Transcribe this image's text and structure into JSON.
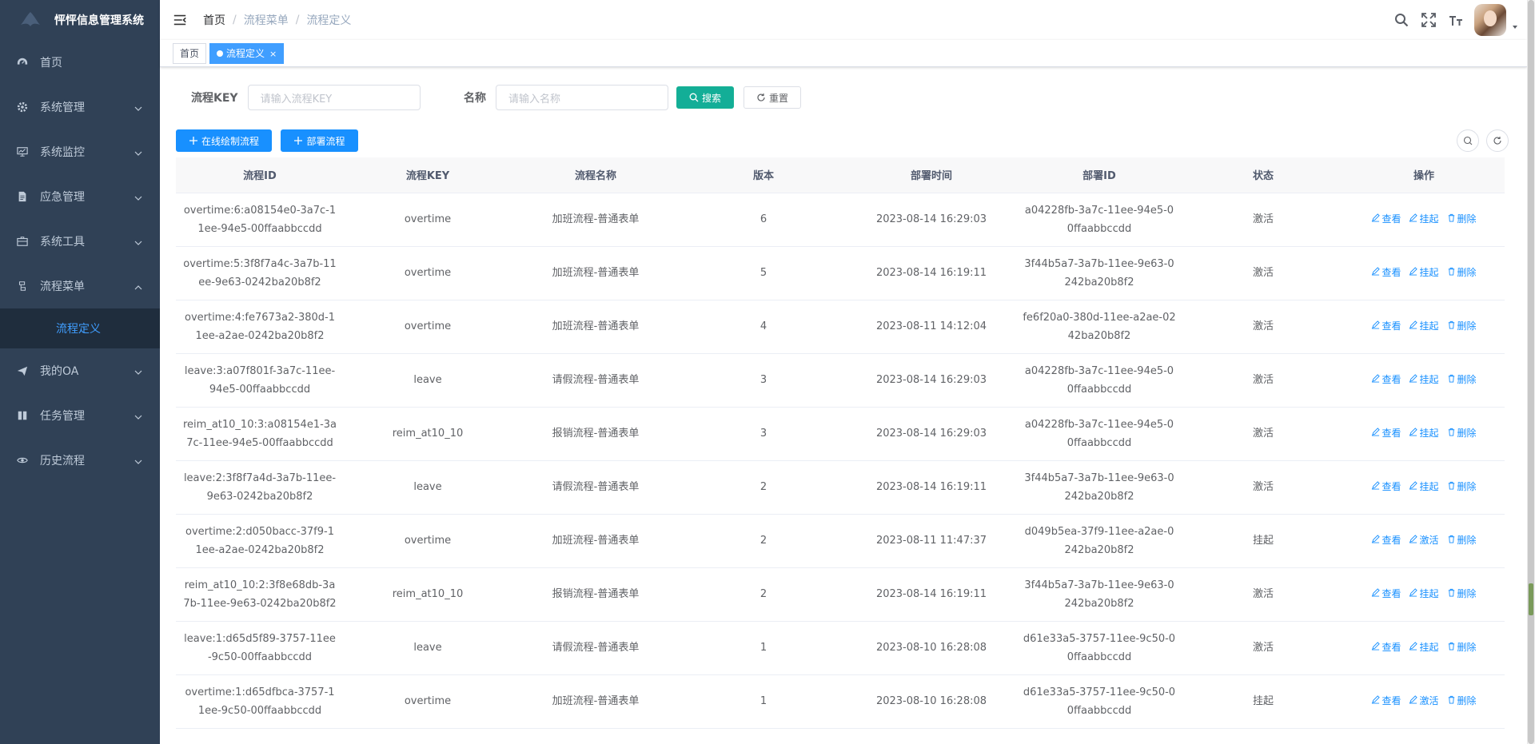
{
  "app": {
    "title": "怦怦信息管理系统"
  },
  "sidebar": {
    "items": [
      {
        "label": "首页",
        "icon": "dashboard-icon"
      },
      {
        "label": "系统管理",
        "icon": "gear-icon"
      },
      {
        "label": "系统监控",
        "icon": "monitor-icon"
      },
      {
        "label": "应急管理",
        "icon": "document-icon"
      },
      {
        "label": "系统工具",
        "icon": "toolbox-icon"
      },
      {
        "label": "流程菜单",
        "icon": "flow-icon"
      },
      {
        "label": "我的OA",
        "icon": "send-icon"
      },
      {
        "label": "任务管理",
        "icon": "book-icon"
      },
      {
        "label": "历史流程",
        "icon": "eye-icon"
      }
    ],
    "submenu": {
      "label": "流程定义"
    }
  },
  "breadcrumb": {
    "home": "首页",
    "level1": "流程菜单",
    "level2": "流程定义",
    "separator": "/"
  },
  "tags": {
    "home": "首页",
    "active": "流程定义",
    "close": "×"
  },
  "search": {
    "key_label": "流程KEY",
    "key_placeholder": "请输入流程KEY",
    "name_label": "名称",
    "name_placeholder": "请输入名称",
    "search_button": "搜索",
    "reset_button": "重置"
  },
  "toolbar": {
    "draw_button": "在线绘制流程",
    "deploy_button": "部署流程"
  },
  "table": {
    "headers": [
      "流程ID",
      "流程KEY",
      "流程名称",
      "版本",
      "部署时间",
      "部署ID",
      "状态",
      "操作"
    ],
    "action_view": "查看",
    "action_delete": "删除",
    "rows": [
      {
        "id": "overtime:6:a08154e0-3a7c-11ee-94e5-00ffaabbccdd",
        "key": "overtime",
        "name": "加班流程-普通表单",
        "version": "6",
        "time": "2023-08-14 16:29:03",
        "deploy_id": "a04228fb-3a7c-11ee-94e5-00ffaabbccdd",
        "status": "激活",
        "toggle": "挂起"
      },
      {
        "id": "overtime:5:3f8f7a4c-3a7b-11ee-9e63-0242ba20b8f2",
        "key": "overtime",
        "name": "加班流程-普通表单",
        "version": "5",
        "time": "2023-08-14 16:19:11",
        "deploy_id": "3f44b5a7-3a7b-11ee-9e63-0242ba20b8f2",
        "status": "激活",
        "toggle": "挂起"
      },
      {
        "id": "overtime:4:fe7673a2-380d-11ee-a2ae-0242ba20b8f2",
        "key": "overtime",
        "name": "加班流程-普通表单",
        "version": "4",
        "time": "2023-08-11 14:12:04",
        "deploy_id": "fe6f20a0-380d-11ee-a2ae-0242ba20b8f2",
        "status": "激活",
        "toggle": "挂起"
      },
      {
        "id": "leave:3:a07f801f-3a7c-11ee-94e5-00ffaabbccdd",
        "key": "leave",
        "name": "请假流程-普通表单",
        "version": "3",
        "time": "2023-08-14 16:29:03",
        "deploy_id": "a04228fb-3a7c-11ee-94e5-00ffaabbccdd",
        "status": "激活",
        "toggle": "挂起"
      },
      {
        "id": "reim_at10_10:3:a08154e1-3a7c-11ee-94e5-00ffaabbccdd",
        "key": "reim_at10_10",
        "name": "报销流程-普通表单",
        "version": "3",
        "time": "2023-08-14 16:29:03",
        "deploy_id": "a04228fb-3a7c-11ee-94e5-00ffaabbccdd",
        "status": "激活",
        "toggle": "挂起"
      },
      {
        "id": "leave:2:3f8f7a4d-3a7b-11ee-9e63-0242ba20b8f2",
        "key": "leave",
        "name": "请假流程-普通表单",
        "version": "2",
        "time": "2023-08-14 16:19:11",
        "deploy_id": "3f44b5a7-3a7b-11ee-9e63-0242ba20b8f2",
        "status": "激活",
        "toggle": "挂起"
      },
      {
        "id": "overtime:2:d050bacc-37f9-11ee-a2ae-0242ba20b8f2",
        "key": "overtime",
        "name": "加班流程-普通表单",
        "version": "2",
        "time": "2023-08-11 11:47:37",
        "deploy_id": "d049b5ea-37f9-11ee-a2ae-0242ba20b8f2",
        "status": "挂起",
        "toggle": "激活"
      },
      {
        "id": "reim_at10_10:2:3f8e68db-3a7b-11ee-9e63-0242ba20b8f2",
        "key": "reim_at10_10",
        "name": "报销流程-普通表单",
        "version": "2",
        "time": "2023-08-14 16:19:11",
        "deploy_id": "3f44b5a7-3a7b-11ee-9e63-0242ba20b8f2",
        "status": "激活",
        "toggle": "挂起"
      },
      {
        "id": "leave:1:d65d5f89-3757-11ee-9c50-00ffaabbccdd",
        "key": "leave",
        "name": "请假流程-普通表单",
        "version": "1",
        "time": "2023-08-10 16:28:08",
        "deploy_id": "d61e33a5-3757-11ee-9c50-00ffaabbccdd",
        "status": "激活",
        "toggle": "挂起"
      },
      {
        "id": "overtime:1:d65dfbca-3757-11ee-9c50-00ffaabbccdd",
        "key": "overtime",
        "name": "加班流程-普通表单",
        "version": "1",
        "time": "2023-08-10 16:28:08",
        "deploy_id": "d61e33a5-3757-11ee-9c50-00ffaabbccdd",
        "status": "挂起",
        "toggle": "激活"
      }
    ]
  },
  "colors": {
    "sidebar_bg": "#304156",
    "accent": "#409eff",
    "primary": "#1890ff",
    "search_btn": "#13ae97"
  }
}
